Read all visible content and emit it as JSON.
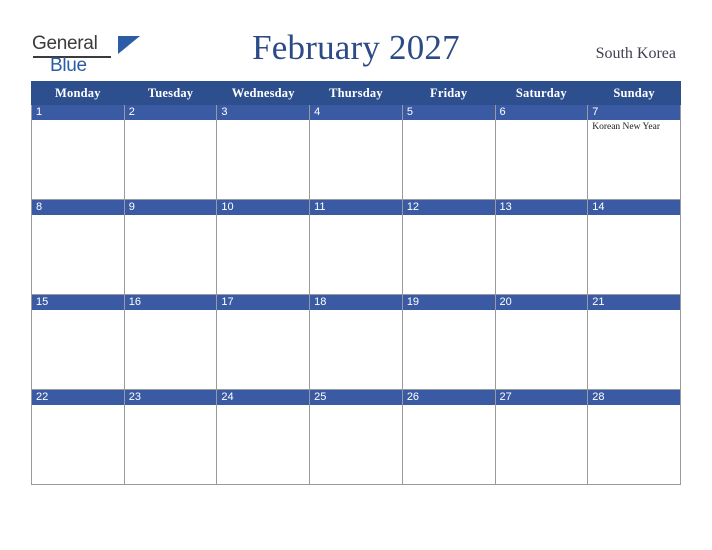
{
  "header": {
    "logo": {
      "general": "General",
      "blue": "Blue",
      "icon": "triangle-icon"
    },
    "title": "February 2027",
    "country": "South Korea"
  },
  "calendar": {
    "weekday_headers": [
      "Monday",
      "Tuesday",
      "Wednesday",
      "Thursday",
      "Friday",
      "Saturday",
      "Sunday"
    ],
    "weeks": [
      [
        {
          "day": "1",
          "events": []
        },
        {
          "day": "2",
          "events": []
        },
        {
          "day": "3",
          "events": []
        },
        {
          "day": "4",
          "events": []
        },
        {
          "day": "5",
          "events": []
        },
        {
          "day": "6",
          "events": []
        },
        {
          "day": "7",
          "events": [
            "Korean New Year"
          ]
        }
      ],
      [
        {
          "day": "8",
          "events": []
        },
        {
          "day": "9",
          "events": []
        },
        {
          "day": "10",
          "events": []
        },
        {
          "day": "11",
          "events": []
        },
        {
          "day": "12",
          "events": []
        },
        {
          "day": "13",
          "events": []
        },
        {
          "day": "14",
          "events": []
        }
      ],
      [
        {
          "day": "15",
          "events": []
        },
        {
          "day": "16",
          "events": []
        },
        {
          "day": "17",
          "events": []
        },
        {
          "day": "18",
          "events": []
        },
        {
          "day": "19",
          "events": []
        },
        {
          "day": "20",
          "events": []
        },
        {
          "day": "21",
          "events": []
        }
      ],
      [
        {
          "day": "22",
          "events": []
        },
        {
          "day": "23",
          "events": []
        },
        {
          "day": "24",
          "events": []
        },
        {
          "day": "25",
          "events": []
        },
        {
          "day": "26",
          "events": []
        },
        {
          "day": "27",
          "events": []
        },
        {
          "day": "28",
          "events": []
        }
      ]
    ]
  },
  "colors": {
    "header_blue": "#2d4f8e",
    "daynum_blue": "#3a5ba3",
    "title_blue": "#2c4a86",
    "logo_blue": "#2c5ca5",
    "border_gray": "#999a9e"
  }
}
